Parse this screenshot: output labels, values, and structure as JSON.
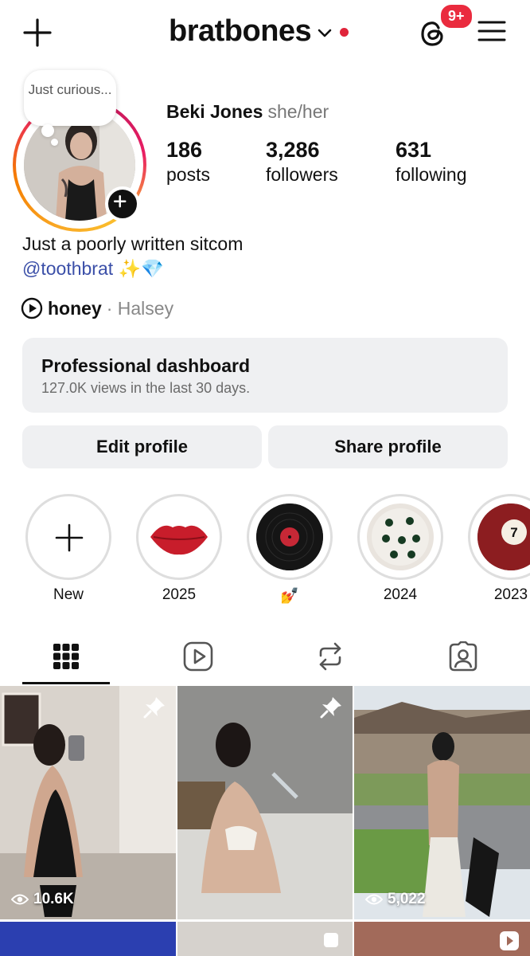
{
  "header": {
    "username": "bratbones",
    "notification_badge": "9+",
    "accent_color": "#e0243a"
  },
  "profile": {
    "note": "Just curious...",
    "full_name": "Beki Jones",
    "pronouns": "she/her",
    "stats": [
      {
        "value": "186",
        "label": "posts"
      },
      {
        "value": "3,286",
        "label": "followers"
      },
      {
        "value": "631",
        "label": "following"
      }
    ],
    "bio_line": "Just a poorly written sitcom",
    "bio_link": "@toothbrat ✨💎",
    "music": {
      "song": "honey",
      "artist": "· Halsey"
    }
  },
  "dashboard": {
    "title": "Professional dashboard",
    "subtitle": "127.0K views in the last 30 days."
  },
  "buttons": {
    "edit": "Edit profile",
    "share": "Share profile"
  },
  "highlights": [
    {
      "label": "New",
      "icon": "plus-icon"
    },
    {
      "label": "2025",
      "icon": "lips-image"
    },
    {
      "label": "💅",
      "icon": "vinyl-record-image"
    },
    {
      "label": "2024",
      "icon": "dice-image"
    },
    {
      "label": "2023",
      "icon": "billiard-ball-image"
    }
  ],
  "tabs": [
    {
      "name": "grid-icon",
      "active": true
    },
    {
      "name": "reels-icon",
      "active": false
    },
    {
      "name": "reposts-icon",
      "active": false
    },
    {
      "name": "tagged-icon",
      "active": false
    }
  ],
  "grid": [
    {
      "views": "10.6K",
      "pinned": true
    },
    {
      "views": "",
      "pinned": true
    },
    {
      "views": "5,022",
      "pinned": false
    }
  ]
}
